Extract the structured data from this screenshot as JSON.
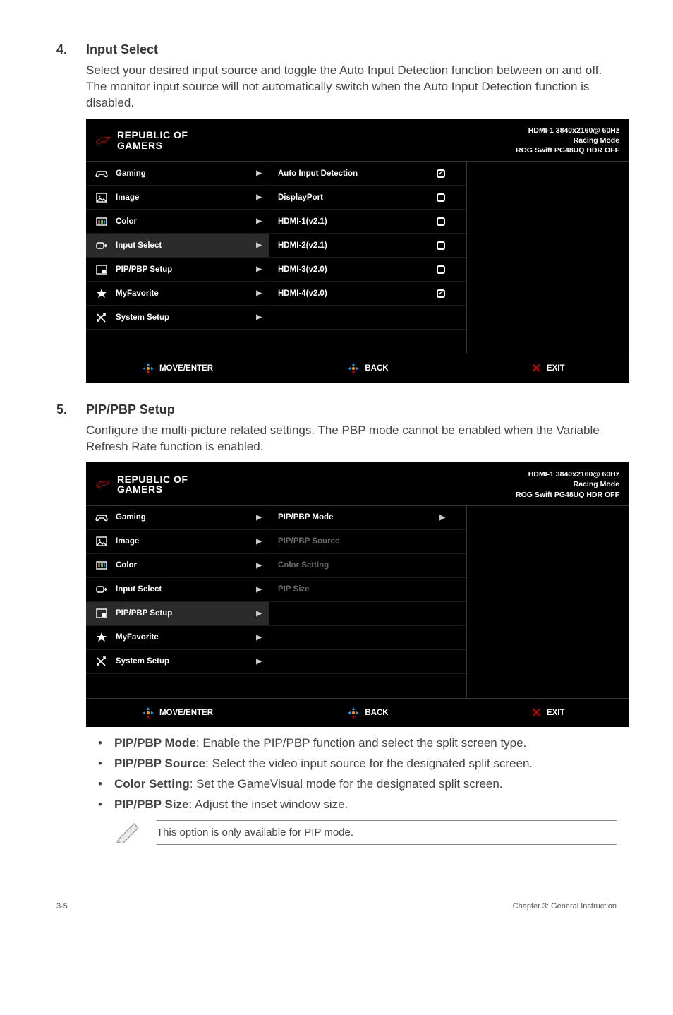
{
  "section4": {
    "num": "4.",
    "title": "Input Select",
    "body": "Select your desired input source and toggle the Auto Input Detection function between on and off. The monitor input source will not automatically switch when the Auto Input Detection function is disabled."
  },
  "section5": {
    "num": "5.",
    "title": "PIP/PBP Setup",
    "body": "Configure the multi-picture related settings. The PBP mode cannot be enabled when the Variable Refresh Rate function is enabled."
  },
  "osd_common": {
    "logo_line1": "REPUBLIC OF",
    "logo_line2": "GAMERS",
    "status_line1": "HDMI-1  3840x2160@  60Hz",
    "status_line2": "Racing Mode",
    "status_line3": "ROG Swift  PG48UQ   HDR OFF",
    "move_enter": "MOVE/ENTER",
    "back": "BACK",
    "exit": "EXIT"
  },
  "osd1": {
    "left": [
      {
        "icon": "gaming",
        "label": "Gaming"
      },
      {
        "icon": "image",
        "label": "Image"
      },
      {
        "icon": "color",
        "label": "Color"
      },
      {
        "icon": "input",
        "label": "Input Select",
        "selected": true
      },
      {
        "icon": "pip",
        "label": "PIP/PBP Setup"
      },
      {
        "icon": "fav",
        "label": "MyFavorite"
      },
      {
        "icon": "setup",
        "label": "System Setup"
      }
    ],
    "right": [
      {
        "label": "Auto Input Detection",
        "state": "on"
      },
      {
        "label": "DisplayPort",
        "state": "off"
      },
      {
        "label": "HDMI-1(v2.1)",
        "state": "off"
      },
      {
        "label": "HDMI-2(v2.1)",
        "state": "off"
      },
      {
        "label": "HDMI-3(v2.0)",
        "state": "off"
      },
      {
        "label": "HDMI-4(v2.0)",
        "state": "on"
      }
    ]
  },
  "osd2": {
    "left": [
      {
        "icon": "gaming",
        "label": "Gaming"
      },
      {
        "icon": "image",
        "label": "Image"
      },
      {
        "icon": "color",
        "label": "Color"
      },
      {
        "icon": "input",
        "label": "Input Select"
      },
      {
        "icon": "pip",
        "label": "PIP/PBP Setup",
        "selected": true
      },
      {
        "icon": "fav",
        "label": "MyFavorite"
      },
      {
        "icon": "setup",
        "label": "System Setup"
      }
    ],
    "right": [
      {
        "label": "PIP/PBP Mode",
        "chev": true
      },
      {
        "label": "PIP/PBP Source",
        "disabled": true
      },
      {
        "label": "Color Setting",
        "disabled": true
      },
      {
        "label": "PIP Size",
        "disabled": true
      }
    ]
  },
  "bullets": [
    {
      "title": "PIP/PBP Mode",
      "rest": ": Enable the PIP/PBP function and select the split screen type."
    },
    {
      "title": "PIP/PBP Source",
      "rest": ": Select the video input source for the designated split screen."
    },
    {
      "title": "Color Setting",
      "rest": ": Set the GameVisual mode for the designated split screen."
    },
    {
      "title": "PIP/PBP Size",
      "rest": ": Adjust the inset window size."
    }
  ],
  "note": "This option is only available for PIP mode.",
  "footer_left": "3-5",
  "footer_right": "Chapter 3: General Instruction"
}
